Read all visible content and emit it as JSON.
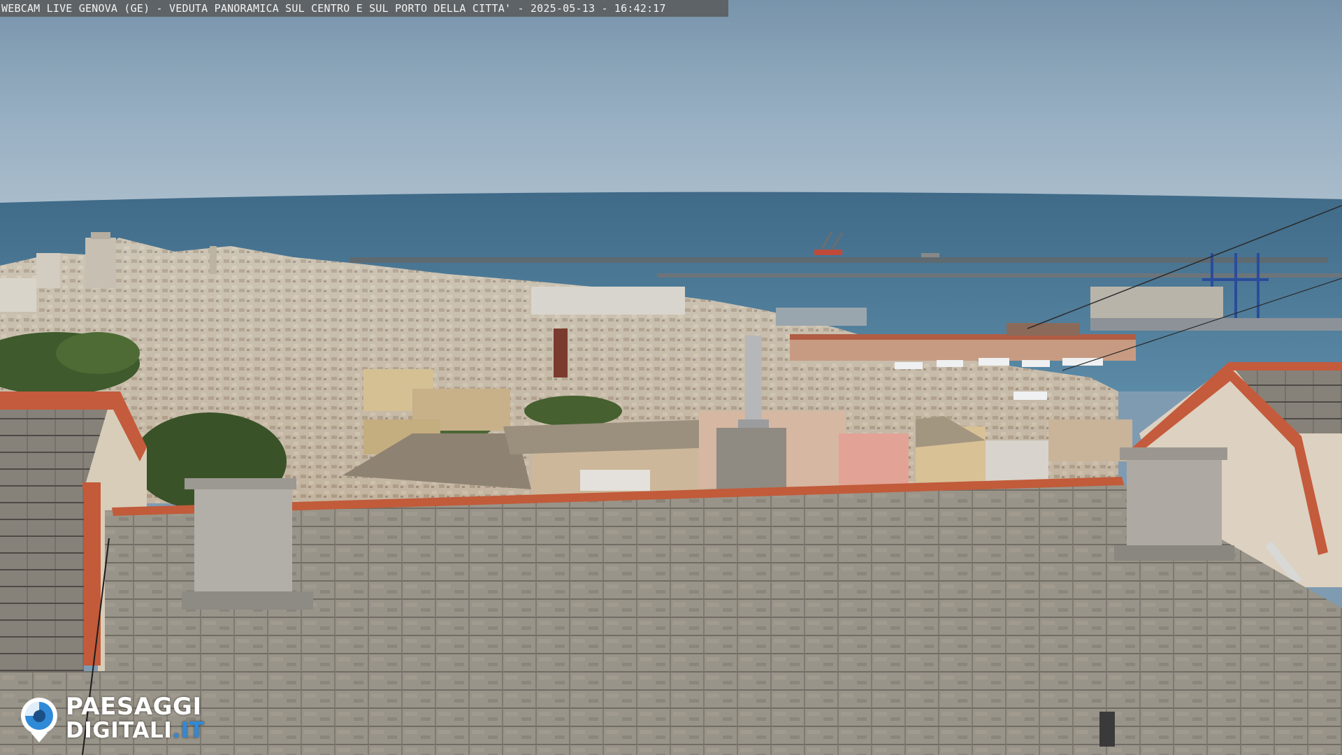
{
  "overlay": {
    "caption": "WEBCAM LIVE GENOVA (GE) - VEDUTA PANORAMICA SUL CENTRO E SUL PORTO DELLA CITTA' - 2025-05-13 - 16:42:17"
  },
  "logo": {
    "line1": "PAESAGGI",
    "line2_main": "DIGITALI",
    "line2_accent": ".IT",
    "icon": "camera-eye-icon",
    "accent_color": "#2f8ad8"
  },
  "scene": {
    "description_colors": {
      "sky": "#8fa9be",
      "sea": "#4f7a96",
      "roof": "#8d877c",
      "terracotta": "#c0623f"
    }
  }
}
